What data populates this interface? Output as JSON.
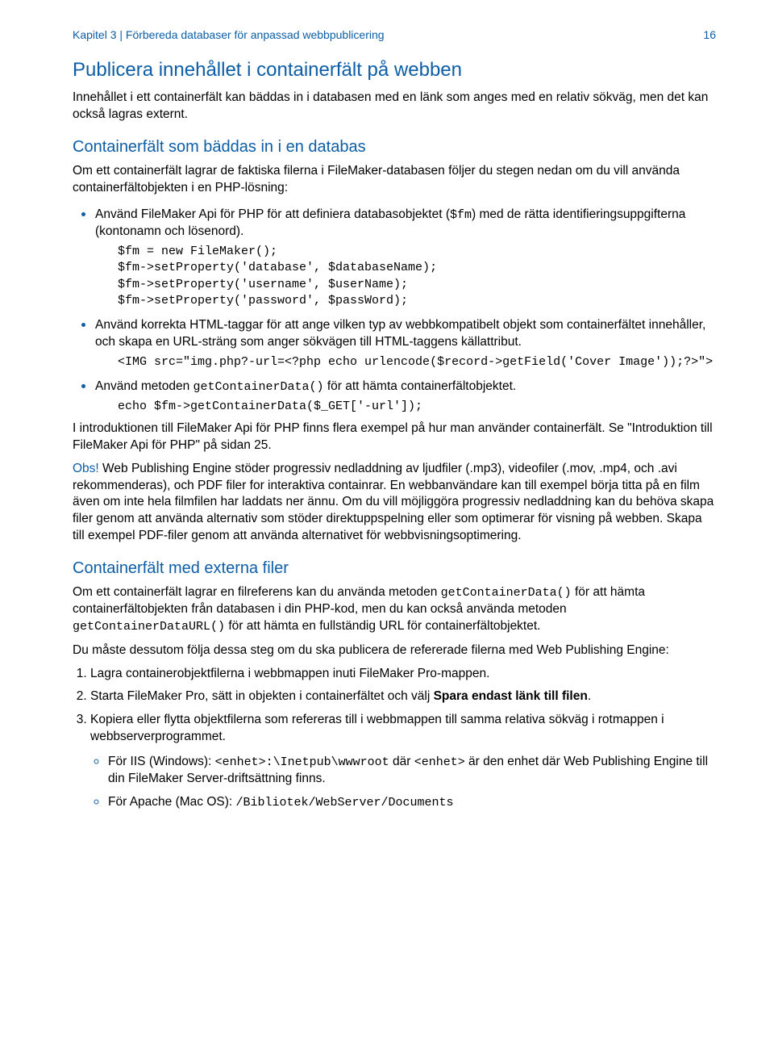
{
  "header": {
    "left": "Kapitel 3  |  Förbereda databaser för anpassad webbpublicering",
    "right": "16"
  },
  "h1": "Publicera innehållet i containerfält på webben",
  "p_intro": "Innehållet i ett containerfält kan bäddas in i databasen med en länk som anges med en relativ sökväg, men det kan också lagras externt.",
  "h2_embed": "Containerfält som bäddas in i en databas",
  "p_embed": "Om ett containerfält lagrar de faktiska filerna i FileMaker-databasen följer du stegen nedan om du vill använda containerfältobjekten i en PHP-lösning:",
  "li_api": {
    "text_a": "Använd FileMaker Api för PHP för att definiera databasobjektet (",
    "code_a": "$fm",
    "text_b": ") med de rätta identifieringsuppgifterna (kontonamn och lösenord)."
  },
  "code_fm": "$fm = new FileMaker();\n$fm->setProperty('database', $databaseName);\n$fm->setProperty('username', $userName);\n$fm->setProperty('password', $passWord);",
  "li_html": "Använd korrekta HTML-taggar för att ange vilken typ av webbkompatibelt objekt som containerfältet innehåller, och skapa en URL-sträng som anger sökvägen till HTML-taggens källattribut.",
  "code_img": "<IMG src=\"img.php?-url=<?php echo urlencode($record->getField('Cover Image'));?>\">",
  "li_getcontainer": {
    "a": "Använd metoden ",
    "code": "getContainerData()",
    "b": " för att hämta containerfältobjektet."
  },
  "code_echo": "echo $fm->getContainerData($_GET['-url']);",
  "p_intro2": "I introduktionen till FileMaker Api för PHP finns flera exempel på hur man använder containerfält. Se \"Introduktion till FileMaker Api för PHP\" på sidan  25.",
  "obs_label": "Obs!",
  "obs_text": "  Web Publishing Engine stöder progressiv nedladdning av ljudfiler (.mp3), videofiler (.mov, .mp4, och .avi rekommenderas), och PDF filer for interaktiva containrar. En webbanvändare kan till exempel börja titta på en film även om inte hela filmfilen har laddats ner ännu. Om du vill möjliggöra progressiv nedladdning kan du behöva skapa filer genom att använda alternativ som stöder direktuppspelning eller som optimerar för visning på webben. Skapa till exempel PDF-filer genom att använda alternativet för webbvisningsoptimering.",
  "h2_ext": "Containerfält med externa filer",
  "p_ext": {
    "a": "Om ett containerfält lagrar en filreferens kan du använda metoden ",
    "code1": "getContainerData()",
    "b": " för att hämta containerfältobjekten från databasen i din PHP-kod, men du kan också använda metoden ",
    "code2": "getContainerDataURL()",
    "c": " för att hämta en fullständig URL för containerfältobjektet."
  },
  "p_must": "Du måste dessutom följa dessa steg om du ska publicera de refererade filerna med Web Publishing Engine:",
  "ol1": "Lagra containerobjektfilerna i webbmappen inuti FileMaker Pro-mappen.",
  "ol2": {
    "a": "Starta FileMaker Pro, sätt in objekten i containerfältet och välj ",
    "bold": "Spara endast länk till filen",
    "b": "."
  },
  "ol3": {
    "text": "Kopiera eller flytta objektfilerna som refereras till i webbmappen till samma relativa sökväg i rotmappen i webbserverprogrammet.",
    "iis": {
      "a": "För IIS (Windows): ",
      "code1": "<enhet>:\\Inetpub\\wwwroot",
      "b": " där ",
      "code2": "<enhet>",
      "c": " är den enhet där Web Publishing Engine till din FileMaker Server-driftsättning finns."
    },
    "apache": {
      "a": "För Apache (Mac OS): ",
      "code": "/Bibliotek/WebServer/Documents"
    }
  }
}
